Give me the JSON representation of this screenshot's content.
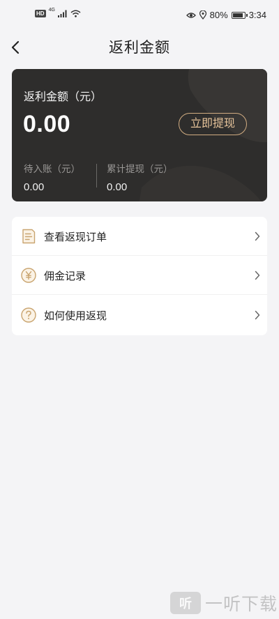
{
  "status_bar": {
    "hd": "HD",
    "network": "4G",
    "battery_percent": "80%",
    "time": "3:34"
  },
  "nav": {
    "title": "返利金额",
    "back_icon": "chevron-left-icon"
  },
  "balance": {
    "label": "返利金额（元）",
    "amount": "0.00",
    "withdraw_label": "立即提现",
    "pending_label": "待入账（元）",
    "pending_value": "0.00",
    "total_label": "累计提现（元）",
    "total_value": "0.00"
  },
  "menu": {
    "items": [
      {
        "label": "查看返现订单",
        "icon": "order-list-icon"
      },
      {
        "label": "佣金记录",
        "icon": "yen-coin-icon"
      },
      {
        "label": "如何使用返现",
        "icon": "question-icon"
      }
    ]
  },
  "colors": {
    "accent_gold": "#d2ad82",
    "card_dark": "#2e2d2c",
    "background": "#f4f4f6"
  },
  "watermark": {
    "text": "一听下载",
    "logo_text": "听"
  }
}
